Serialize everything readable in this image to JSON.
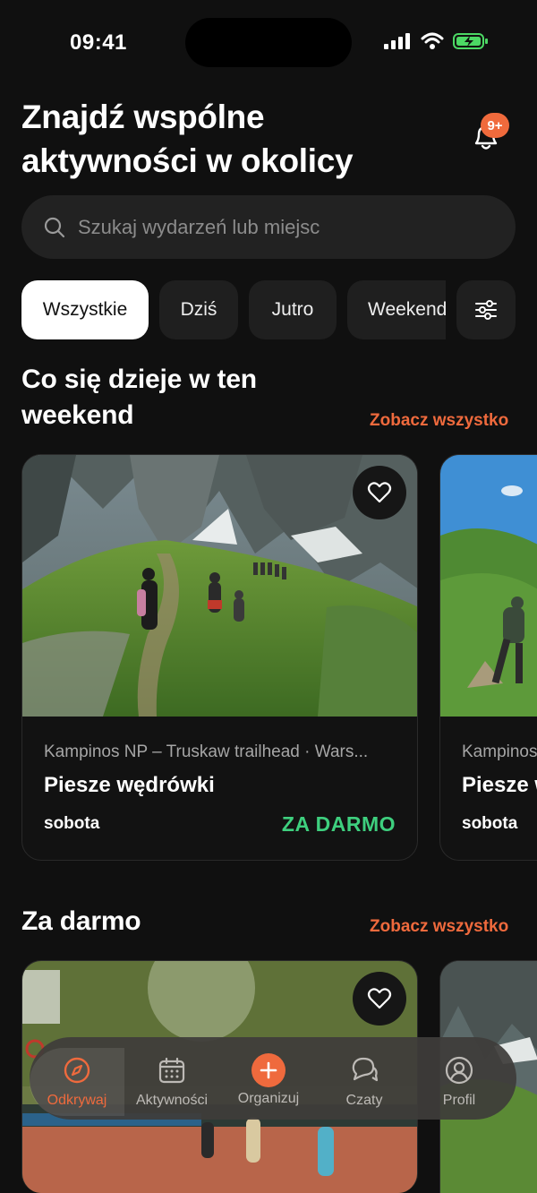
{
  "status_bar": {
    "time": "09:41"
  },
  "header": {
    "title_line1": "Znajdź wspólne",
    "title_line2": "aktywności w okolicy",
    "notifications_badge": "9+"
  },
  "search": {
    "placeholder": "Szukaj wydarzeń lub miejsc"
  },
  "filters": {
    "chips": [
      "Wszystkie",
      "Dziś",
      "Jutro",
      "Weekend"
    ],
    "active": "Wszystkie",
    "settings_icon": "sliders-icon"
  },
  "weekend_section": {
    "title_line1": "Co się dzieje w ten",
    "title_line2": "weekend",
    "see_all": "Zobacz wszystko",
    "cards": [
      {
        "location": "Kampinos NP – Truskaw trailhead · Wars...",
        "name": "Piesze wędrówki",
        "day": "sobota",
        "price": "ZA DARMO"
      },
      {
        "location": "Kampinos",
        "name": "Piesze w",
        "day": "sobota"
      }
    ]
  },
  "free_section": {
    "title": "Za darmo",
    "see_all": "Zobacz wszystko"
  },
  "bottom_nav": {
    "items": [
      "Odkrywaj",
      "Aktywności",
      "Organizuj",
      "Czaty",
      "Profil"
    ],
    "active": "Odkrywaj"
  },
  "colors": {
    "accent": "#ef6a3d",
    "free_price": "#3ecf7e",
    "background": "#101010"
  }
}
